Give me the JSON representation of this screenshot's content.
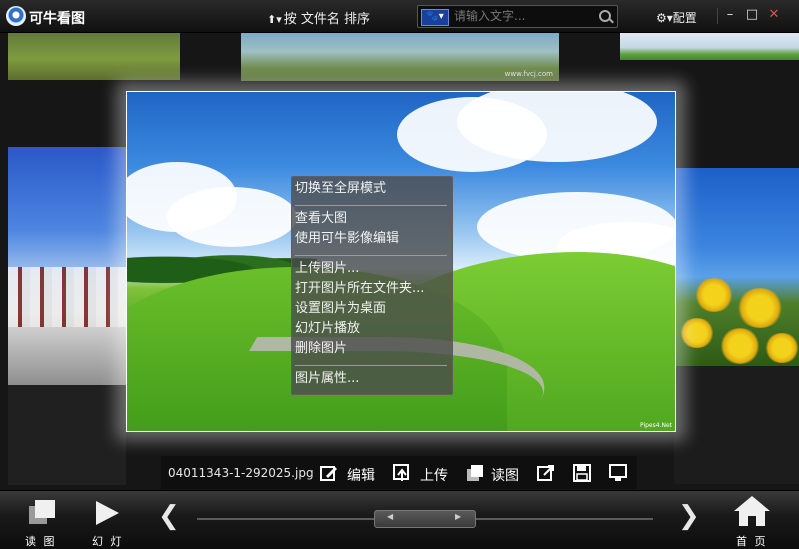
{
  "app": {
    "title": "可牛看图"
  },
  "toolbar": {
    "sort_label": "按 文件名 排序",
    "sort_arrow": "⬆▾",
    "config_label": "⚙▾配置"
  },
  "search": {
    "placeholder": "请输入文字...",
    "engine": "🐾▾"
  },
  "window_controls": {
    "minimize": "–",
    "maximize": "□",
    "close": "✕"
  },
  "context_menu": {
    "items": [
      "切换至全屏模式",
      "查看大图",
      "使用可牛影像编辑",
      "上传图片...",
      "打开图片所在文件夹...",
      "设置图片为桌面",
      "幻灯片播放",
      "删除图片",
      "图片属性..."
    ]
  },
  "action_bar": {
    "filename": "04011343-1-292025.jpg",
    "edit_label": "编辑",
    "upload_label": "上传",
    "read_label": "读图"
  },
  "bottom_bar": {
    "read_label": "读 图",
    "slide_label": "幻 灯",
    "home_label": "首 页",
    "prev": "❮",
    "next": "❯",
    "scroll_left": "◀",
    "scroll_right": "▶"
  },
  "watermarks": {
    "tile": "www.fvcj.com",
    "main": "Pipes4.Net"
  },
  "colors": {
    "background": "#161616",
    "menu": "#4b4b4b",
    "accent": "#1b3f9c"
  }
}
